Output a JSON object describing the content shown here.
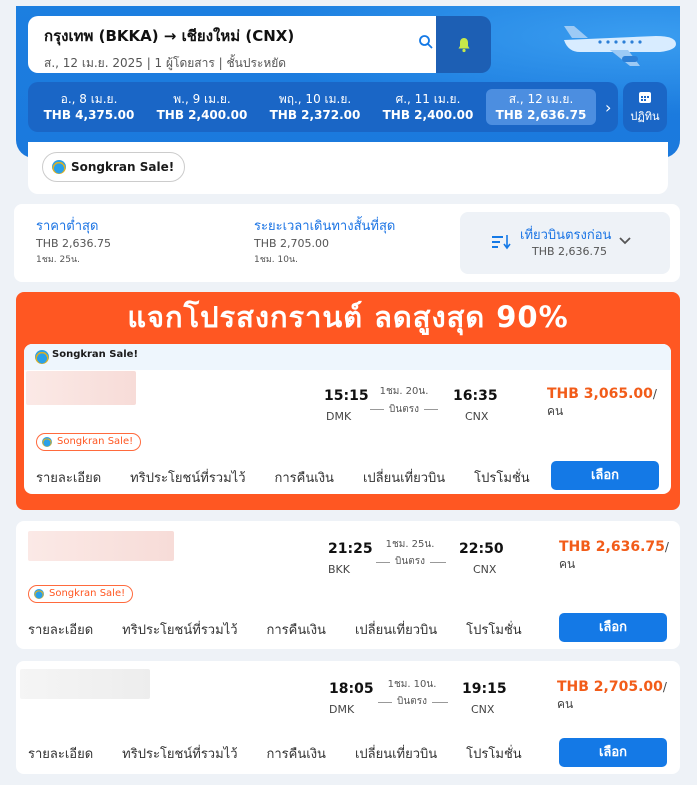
{
  "search": {
    "route": "กรุงเทพ (BKKA) → เชียงใหม่ (CNX)",
    "details": "ส., 12 เม.ย. 2025  |  1 ผู้โดยสาร  |  ชั้นประหยัด"
  },
  "dates": [
    {
      "day": "อ., 8 เม.ย.",
      "price": "THB 4,375.00",
      "selected": false
    },
    {
      "day": "พ., 9 เม.ย.",
      "price": "THB 2,400.00",
      "selected": false
    },
    {
      "day": "พฤ., 10 เม.ย.",
      "price": "THB 2,372.00",
      "selected": false
    },
    {
      "day": "ศ., 11 เม.ย.",
      "price": "THB 2,400.00",
      "selected": false
    },
    {
      "day": "ส., 12 เม.ย.",
      "price": "THB 2,636.75",
      "selected": true
    }
  ],
  "calendar_label": "ปฏิทิน",
  "promo_pill": "Songkran Sale!",
  "sort": {
    "cheapest_title": "ราคาต่ำสุด",
    "cheapest_price": "THB 2,636.75",
    "cheapest_dur": "1ชม. 25น.",
    "shortest_title": "ระยะเวลาเดินทางสั้นที่สุด",
    "shortest_price": "THB 2,705.00",
    "shortest_dur": "1ชม. 10น.",
    "direct_title": "เที่ยวบินตรงก่อน",
    "direct_price": "THB 2,636.75"
  },
  "banner_text": "แจกโปรสงกรานต์   ลดสูงสุด 90%",
  "banner_sale_label": "Songkran Sale!",
  "flights": [
    {
      "dep_time": "15:15",
      "dep_code": "DMK",
      "arr_time": "16:35",
      "arr_code": "CNX",
      "duration": "1ชม. 20น.",
      "type": "บินตรง",
      "price": "THB 3,065.00",
      "tag": "Songkran Sale!"
    },
    {
      "dep_time": "21:25",
      "dep_code": "BKK",
      "arr_time": "22:50",
      "arr_code": "CNX",
      "duration": "1ชม. 25น.",
      "type": "บินตรง",
      "price": "THB 2,636.75",
      "tag": "Songkran Sale!"
    },
    {
      "dep_time": "18:05",
      "dep_code": "DMK",
      "arr_time": "19:15",
      "arr_code": "CNX",
      "duration": "1ชม. 10น.",
      "type": "บินตรง",
      "price": "THB 2,705.00",
      "tag": ""
    }
  ],
  "per_person": "/คน",
  "links": [
    "รายละเอียด",
    "ทริประโยชน์ที่รวมไว้",
    "การคืนเงิน",
    "เปลี่ยนเที่ยวบิน",
    "โปรโมชั่น"
  ],
  "select_label": "เลือก",
  "colors": {
    "primary": "#1479e6",
    "sale": "#ff5722",
    "price": "#f25c19"
  }
}
